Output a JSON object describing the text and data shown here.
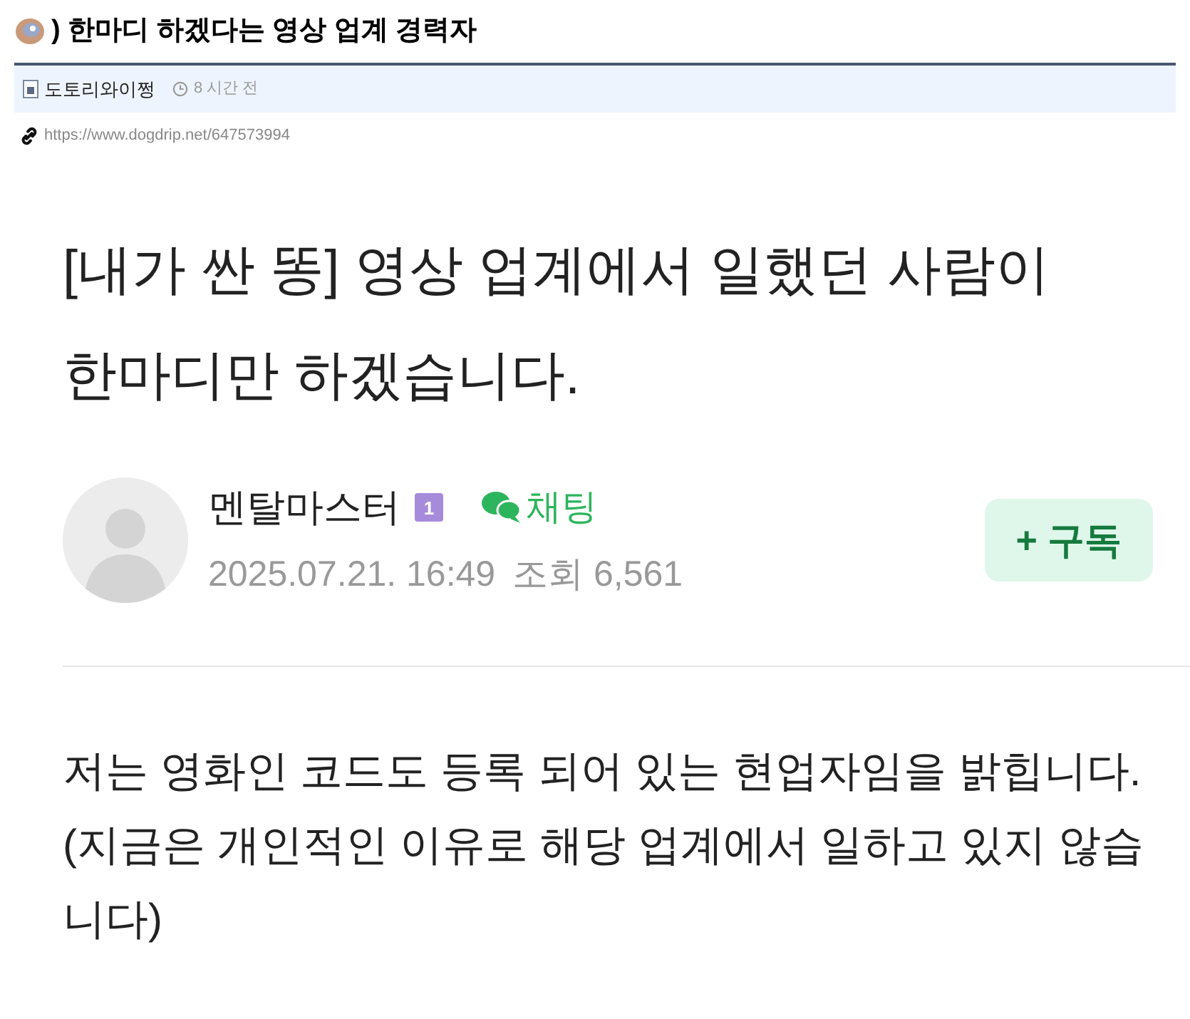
{
  "post": {
    "title": ") 한마디 하겠다는 영상 업계 경력자",
    "author": "도토리와이쩡",
    "time": "8 시간 전",
    "url": "https://www.dogdrip.net/647573994"
  },
  "embed": {
    "title": "[내가 싼 똥] 영상 업계에서 일했던 사람이 한마디만 하겠습니다.",
    "author": "멘탈마스터",
    "level_badge": "1",
    "chat": "채팅",
    "date": "2025.07.21. 16:49",
    "views": "조회 6,561",
    "subscribe": "+ 구독",
    "body": "저는 영화인 코드도 등록 되어 있는 현업자임을 밝힙니다. (지금은 개인적인 이유로 해당 업계에서 일하고 있지 않습니다)"
  }
}
